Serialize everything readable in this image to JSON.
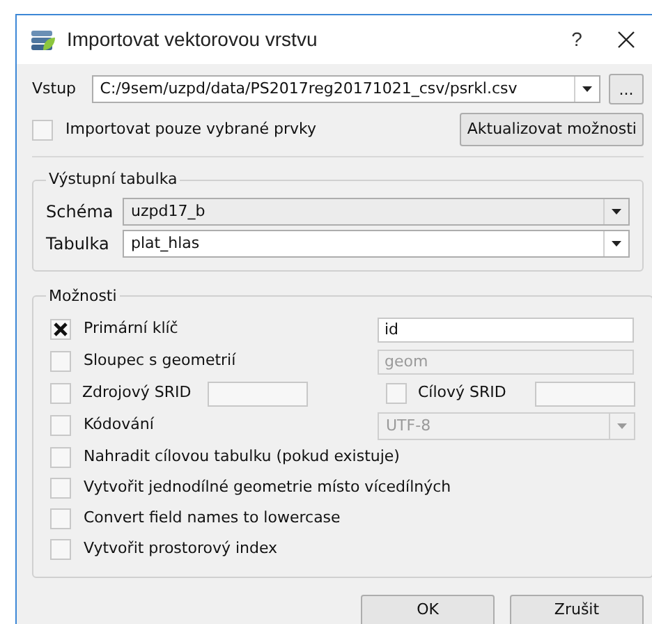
{
  "window": {
    "title": "Importovat vektorovou vrstvu",
    "help": "?"
  },
  "input": {
    "label": "Vstup",
    "value": "C:/9sem/uzpd/data/PS2017reg20171021_csv/psrkl.csv",
    "browse": "..."
  },
  "selected_only": {
    "label": "Importovat pouze vybrané prvky",
    "checked": false
  },
  "update_button": "Aktualizovat možnosti",
  "output_table": {
    "title": "Výstupní tabulka",
    "rows": [
      {
        "label": "Schéma",
        "value": "uzpd17_b",
        "editable": false
      },
      {
        "label": "Tabulka",
        "value": "plat_hlas",
        "editable": true
      }
    ]
  },
  "options": {
    "title": "Možnosti",
    "items": [
      {
        "kind": "field",
        "label": "Primární klíč",
        "checked": true,
        "value": "id",
        "disabled": false
      },
      {
        "kind": "field",
        "label": "Sloupec s geometrií",
        "checked": false,
        "value": "geom",
        "disabled": true
      },
      {
        "kind": "pair",
        "items": [
          {
            "label": "Zdrojový SRID",
            "checked": false
          },
          {
            "label": "Cílový SRID",
            "checked": false
          }
        ]
      },
      {
        "kind": "combo",
        "label": "Kódování",
        "checked": false,
        "value": "UTF-8",
        "disabled": true
      },
      {
        "kind": "check",
        "label": "Nahradit cílovou tabulku (pokud existuje)",
        "checked": false
      },
      {
        "kind": "check",
        "label": "Vytvořit jednodílné geometrie místo vícedílných",
        "checked": false
      },
      {
        "kind": "check",
        "label": "Convert field names to lowercase",
        "checked": false
      },
      {
        "kind": "check",
        "label": "Vytvořit prostorový index",
        "checked": false
      }
    ]
  },
  "buttons": [
    "OK",
    "Zrušit"
  ]
}
